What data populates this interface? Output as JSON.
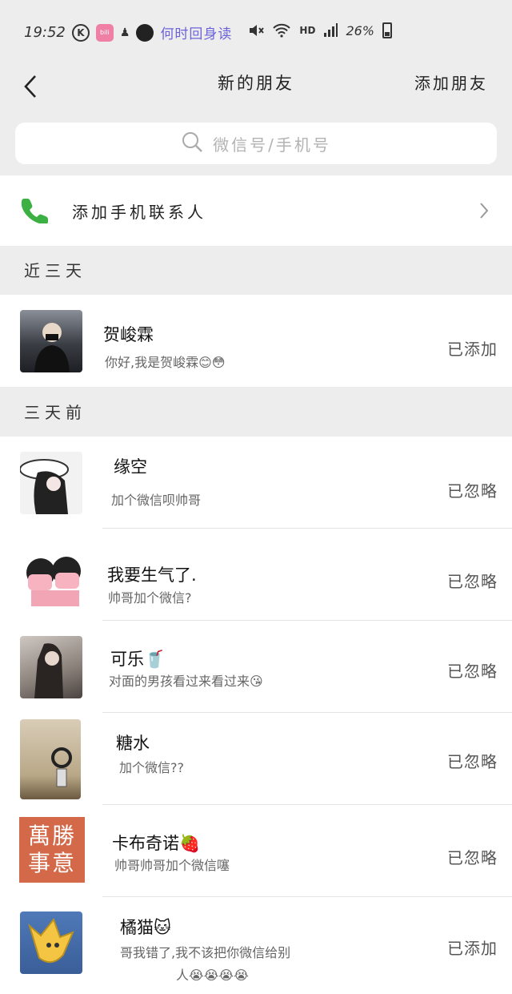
{
  "status_bar": {
    "time": "19:52",
    "scroll_text": "何时回身读",
    "network": "HD",
    "battery": "26%"
  },
  "nav": {
    "title": "新的朋友",
    "action": "添加朋友"
  },
  "search": {
    "placeholder": "微信号/手机号"
  },
  "add_contacts": {
    "label": "添加手机联系人"
  },
  "sections": {
    "recent": "近三天",
    "older": "三天前"
  },
  "recent_items": [
    {
      "name": "贺峻霖",
      "message": "你好,我是贺峻霖😊😳",
      "status": "已添加"
    }
  ],
  "older_items": [
    {
      "name": "缘空",
      "message": "加个微信呗帅哥",
      "status": "已忽略"
    },
    {
      "name": "我要生气了.",
      "message": "帅哥加个微信?",
      "status": "已忽略"
    },
    {
      "name": "可乐🥤",
      "message": "对面的男孩看过来看过来😘",
      "status": "已忽略"
    },
    {
      "name": "糖水",
      "message": "加个微信??",
      "status": "已忽略"
    },
    {
      "name": "卡布奇诺🍓",
      "message": "帅哥帅哥加个微信噻",
      "status": "已忽略",
      "avatar_text": "萬勝事意"
    },
    {
      "name": "橘猫🐱",
      "message": "哥我错了,我不该把你微信给别",
      "message_line2": "人😭😭😭😭",
      "status": "已添加"
    }
  ],
  "colors": {
    "background": "#ededed",
    "phone_icon": "#3cb043",
    "avatar_red": "#d4694a"
  }
}
